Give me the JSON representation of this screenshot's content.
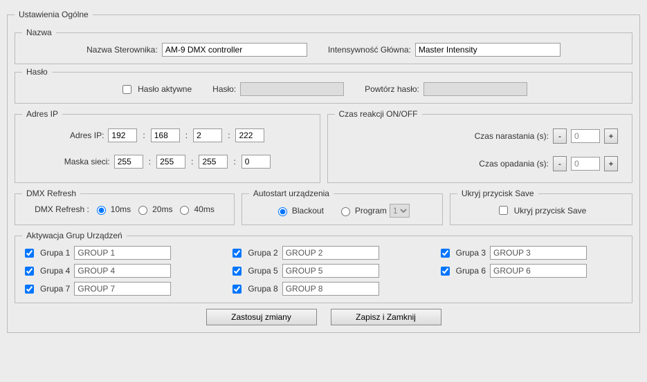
{
  "main": {
    "legend": "Ustawienia Ogólne"
  },
  "name_section": {
    "legend": "Nazwa",
    "controller_label": "Nazwa Sterownika:",
    "controller_value": "AM-9 DMX controller",
    "intensity_label": "Intensywność Główna:",
    "intensity_value": "Master Intensity"
  },
  "password_section": {
    "legend": "Hasło",
    "active_label": "Hasło aktywne",
    "active_checked": false,
    "password_label": "Hasło:",
    "password_value": "",
    "repeat_label": "Powtórz hasło:",
    "repeat_value": ""
  },
  "ip_section": {
    "legend": "Adres IP",
    "ip_label": "Adres IP:",
    "ip": [
      "192",
      "168",
      "2",
      "222"
    ],
    "mask_label": "Maska sieci:",
    "mask": [
      "255",
      "255",
      "255",
      "0"
    ]
  },
  "reaction_section": {
    "legend": "Czas reakcji ON/OFF",
    "rise_label": "Czas narastania (s):",
    "rise_value": "0",
    "fall_label": "Czas opadania (s):",
    "fall_value": "0",
    "minus": "-",
    "plus": "+"
  },
  "dmx_section": {
    "legend": "DMX Refresh",
    "label": "DMX Refresh :",
    "options": [
      "10ms",
      "20ms",
      "40ms"
    ],
    "selected": "10ms"
  },
  "autostart_section": {
    "legend": "Autostart urządzenia",
    "blackout_label": "Blackout",
    "program_label": "Program",
    "selected": "Blackout",
    "program_value": "1"
  },
  "hide_save_section": {
    "legend": "Ukryj przycisk Save",
    "label": "Ukryj przycisk Save",
    "checked": false
  },
  "groups_section": {
    "legend": "Aktywacja Grup Urządzeń",
    "groups": [
      {
        "label": "Grupa 1",
        "value": "GROUP 1",
        "checked": true
      },
      {
        "label": "Grupa 2",
        "value": "GROUP 2",
        "checked": true
      },
      {
        "label": "Grupa 3",
        "value": "GROUP 3",
        "checked": true
      },
      {
        "label": "Grupa 4",
        "value": "GROUP 4",
        "checked": true
      },
      {
        "label": "Grupa 5",
        "value": "GROUP 5",
        "checked": true
      },
      {
        "label": "Grupa 6",
        "value": "GROUP 6",
        "checked": true
      },
      {
        "label": "Grupa 7",
        "value": "GROUP 7",
        "checked": true
      },
      {
        "label": "Grupa 8",
        "value": "GROUP 8",
        "checked": true
      }
    ]
  },
  "buttons": {
    "apply": "Zastosuj zmiany",
    "save_close": "Zapisz i Zamknij"
  }
}
